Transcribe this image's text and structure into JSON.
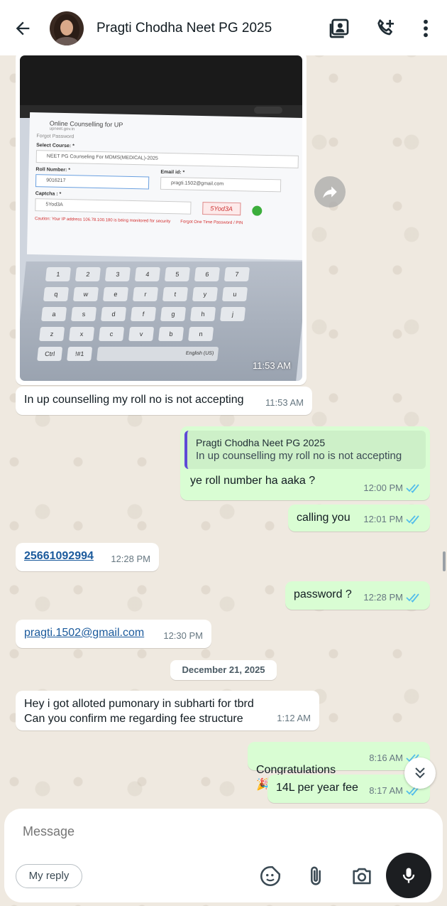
{
  "header": {
    "contact_name": "Pragti Chodha Neet PG 2025",
    "icons": [
      "back-arrow-icon",
      "contact-card-icon",
      "add-call-icon",
      "more-vertical-icon"
    ]
  },
  "photo": {
    "time": "11:53 AM",
    "screen": {
      "title": "Online Counselling for UP",
      "subtitle": "upneet.gov.in",
      "forgot": "Forgot Password",
      "select_course_label": "Select Course: *",
      "course_value": "NEET PG Counseling For MDMS(MEDICAL)-2025",
      "roll_label": "Roll Number: *",
      "roll_value": "9016217",
      "email_label": "Email id: *",
      "email_value": "pragti.1502@gmail.com",
      "captcha_label": "Captcha : *",
      "captcha_value": "5Yod3A",
      "captcha_image": "5Yod3A",
      "warning": "Caution: Your IP address 106.78.100.180 is being monitored for security",
      "otp_link": "Forgot One Time Password / PIN"
    },
    "keyboard_rows": [
      [
        "1",
        "2",
        "3",
        "4",
        "5",
        "6",
        "7"
      ],
      [
        "q",
        "w",
        "e",
        "r",
        "t",
        "y",
        "u"
      ],
      [
        "a",
        "s",
        "d",
        "f",
        "g",
        "h",
        "j"
      ],
      [
        "z",
        "x",
        "c",
        "v",
        "b",
        "n"
      ]
    ],
    "keyboard_extra": [
      "Ctrl",
      "!#1",
      "English (US)"
    ]
  },
  "messages": {
    "m1": {
      "text": "In up counselling my roll no is not accepting",
      "time": "11:53 AM"
    },
    "m2": {
      "quote_name": "Pragti Chodha Neet PG 2025",
      "quote_text": "In up counselling my roll no is not accepting",
      "text": "ye roll number ha aaka ?",
      "time": "12:00 PM"
    },
    "m3": {
      "text": "calling you",
      "time": "12:01 PM"
    },
    "m4": {
      "text": "25661092994",
      "time": "12:28 PM"
    },
    "m5": {
      "text": "password ?",
      "time": "12:28 PM"
    },
    "m6": {
      "text": "pragti.1502@gmail.com",
      "time": "12:30 PM"
    },
    "date_chip": "December 21, 2025",
    "m7": {
      "text": "Hey i got alloted pumonary in subharti for tbrd\nCan you confirm me regarding fee structure",
      "time": "1:12 AM"
    },
    "m8": {
      "text": "Congratulations",
      "emoji": "🎉",
      "time": "8:16 AM"
    },
    "m9": {
      "text": "14L per year fee",
      "time": "8:17 AM"
    }
  },
  "composer": {
    "placeholder": "Message",
    "my_reply_label": "My reply",
    "icons": [
      "sticker-icon",
      "attach-icon",
      "camera-icon",
      "mic-icon"
    ]
  },
  "colors": {
    "outgoing_bubble": "#d9fdd3",
    "incoming_bubble": "#ffffff",
    "read_ticks": "#53bdeb",
    "quote_bar": "#5e4bd6"
  }
}
